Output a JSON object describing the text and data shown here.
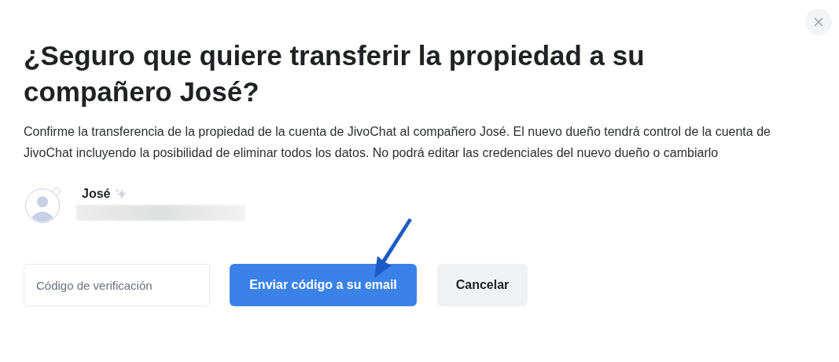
{
  "dialog": {
    "title": "¿Seguro que quiere transferir la propiedad a su compañero José?",
    "description": "Confirme la transferencia de la propiedad de la cuenta de JivoChat al compañero José. El nuevo dueño tendrá control de la cuenta de JivoChat incluyendo la posibilidad de eliminar todos los datos. No podrá editar las credenciales del nuevo dueño o cambiarlo",
    "user": {
      "name": "José"
    },
    "code_field": {
      "placeholder": "Código de verificación"
    },
    "buttons": [
      {
        "kind": "primary",
        "label": "Enviar código a su email"
      },
      {
        "kind": "secondary",
        "label": "Cancelar"
      }
    ]
  }
}
